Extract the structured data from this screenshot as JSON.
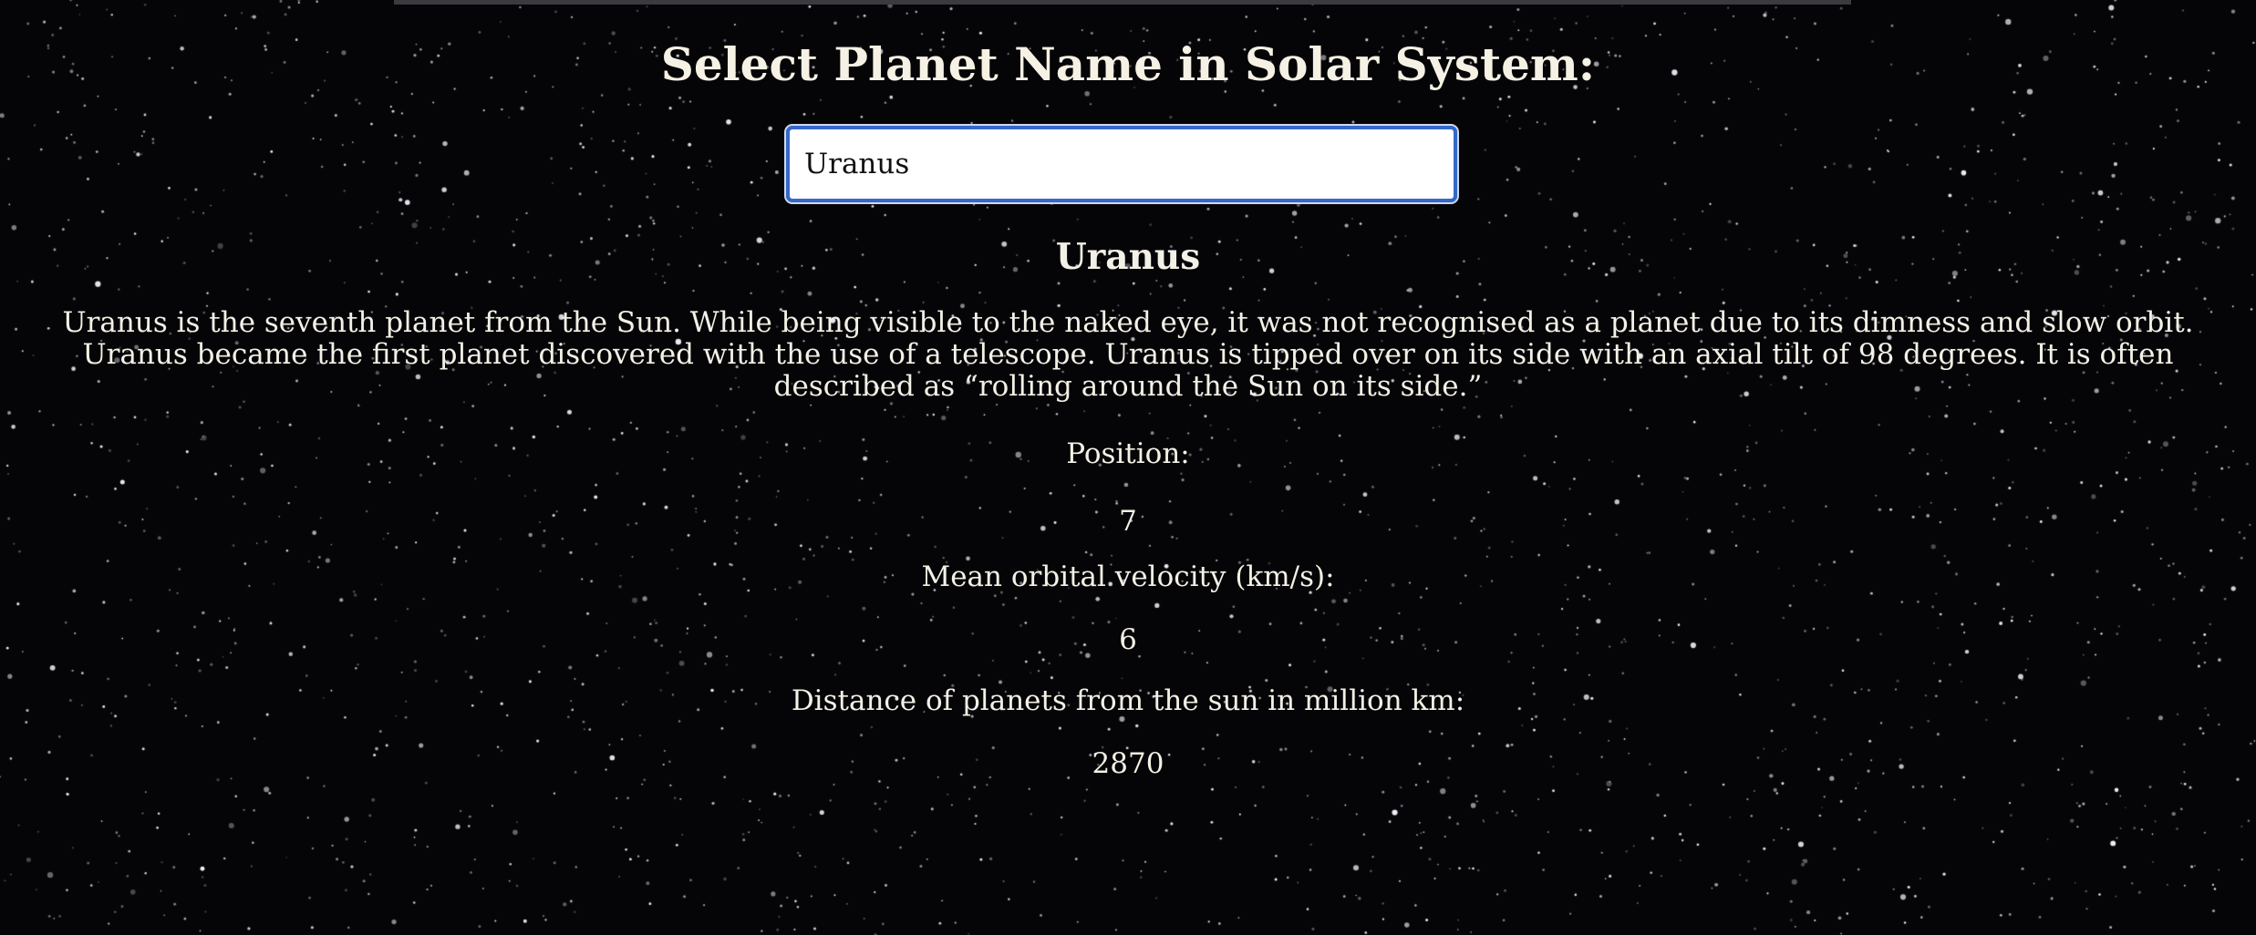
{
  "header": {
    "title": "Select Planet Name in Solar System:"
  },
  "planet_select": {
    "selected": "Uranus"
  },
  "planet": {
    "name": "Uranus",
    "description": "Uranus is the seventh planet from the Sun. While being visible to the naked eye, it was not recognised as a planet due to its dimness and slow orbit. Uranus became the first planet discovered with the use of a telescope. Uranus is tipped over on its side with an axial tilt of 98 degrees. It is often described as “rolling around the Sun on its side.”",
    "position_label": "Position:",
    "position_value": "7",
    "velocity_label": "Mean orbital velocity (km/s):",
    "velocity_value": "6",
    "distance_label": "Distance of planets from the sun in million km:",
    "distance_value": "2870"
  },
  "colors": {
    "background": "#050507",
    "text": "#f3f0e6",
    "input_border": "#3468c9"
  }
}
